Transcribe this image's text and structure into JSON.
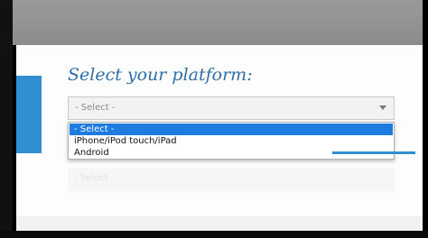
{
  "form": {
    "title": "Select your platform:",
    "select_value": "- Select -",
    "second_select_value": "- Select -"
  },
  "dropdown": {
    "options": [
      {
        "label": "- Select -",
        "selected": true
      },
      {
        "label": "iPhone/iPod touch/iPad",
        "selected": false
      },
      {
        "label": "Android",
        "selected": false
      }
    ]
  },
  "colors": {
    "accent": "#2f8fd1",
    "title": "#2d6fa6",
    "highlight": "#1e7be0"
  },
  "icons": {
    "dropdown_arrow": "chevron-down-icon"
  }
}
